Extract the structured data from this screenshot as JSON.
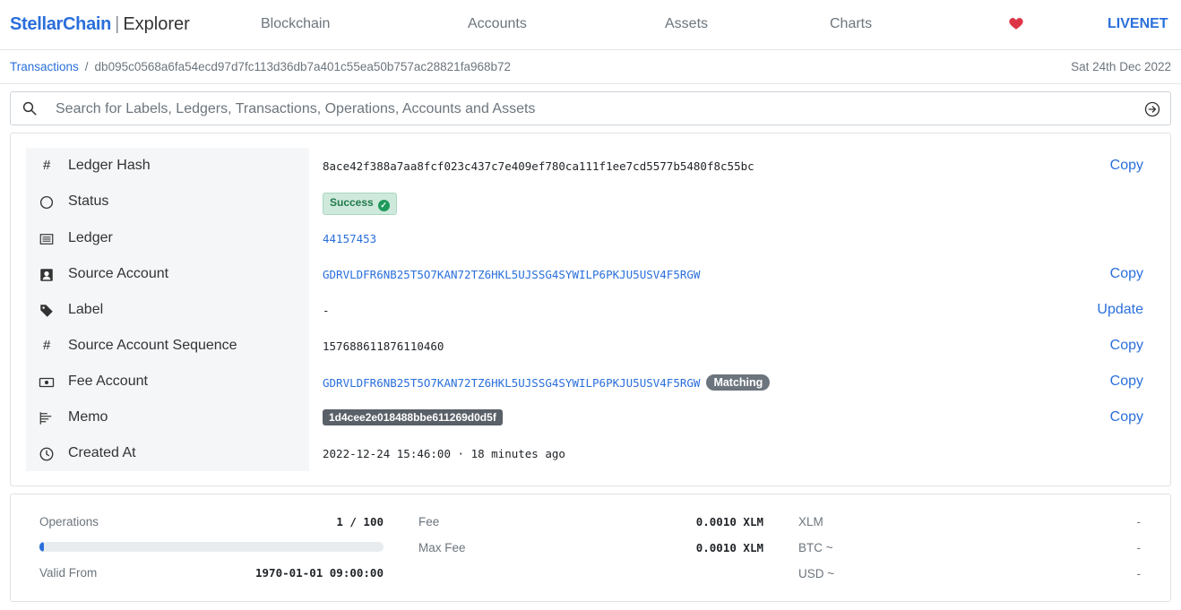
{
  "brand": {
    "name": "StellarChain",
    "sub": "Explorer"
  },
  "nav": {
    "items": [
      "Blockchain",
      "Accounts",
      "Assets",
      "Charts"
    ],
    "network": "LIVENET"
  },
  "breadcrumb": {
    "parent": "Transactions",
    "current": "db095c0568a6fa54ecd97d7fc113d36db7a401c55ea50b757ac28821fa968b72",
    "date": "Sat 24th Dec 2022"
  },
  "search": {
    "placeholder": "Search for Labels, Ledgers, Transactions, Operations, Accounts and Assets"
  },
  "details": {
    "ledger_hash": {
      "label": "Ledger Hash",
      "value": "8ace42f388a7aa8fcf023c437c7e409ef780ca111f1ee7cd5577b5480f8c55bc",
      "action": "Copy"
    },
    "status": {
      "label": "Status",
      "value": "Success"
    },
    "ledger": {
      "label": "Ledger",
      "value": "44157453"
    },
    "source_account": {
      "label": "Source Account",
      "value": "GDRVLDFR6NB25T5O7KAN72TZ6HKL5UJSSG4SYWILP6PKJU5USV4F5RGW",
      "action": "Copy"
    },
    "label": {
      "label": "Label",
      "value": "-",
      "action": "Update"
    },
    "sequence": {
      "label": "Source Account Sequence",
      "value": "157688611876110460",
      "action": "Copy"
    },
    "fee_account": {
      "label": "Fee Account",
      "value": "GDRVLDFR6NB25T5O7KAN72TZ6HKL5UJSSG4SYWILP6PKJU5USV4F5RGW",
      "badge": "Matching",
      "action": "Copy"
    },
    "memo": {
      "label": "Memo",
      "value": "1d4cee2e018488bbe611269d0d5f",
      "action": "Copy"
    },
    "created_at": {
      "label": "Created At",
      "value": "2022-12-24 15:46:00 · 18 minutes ago"
    }
  },
  "stats": {
    "operations_label": "Operations",
    "operations_value": "1 / 100",
    "operations_fraction": 0.01,
    "valid_from_label": "Valid From",
    "valid_from_value": "1970-01-01 09:00:00",
    "fee_label": "Fee",
    "fee_value": "0.0010 XLM",
    "max_fee_label": "Max Fee",
    "max_fee_value": "0.0010 XLM",
    "xlm_label": "XLM",
    "xlm_value": "-",
    "btc_label": "BTC ~",
    "btc_value": "-",
    "usd_label": "USD ~",
    "usd_value": "-"
  },
  "colors": {
    "accent": "#2a6fdb",
    "heart": "#dc3545",
    "success": "#1e9a5b"
  }
}
